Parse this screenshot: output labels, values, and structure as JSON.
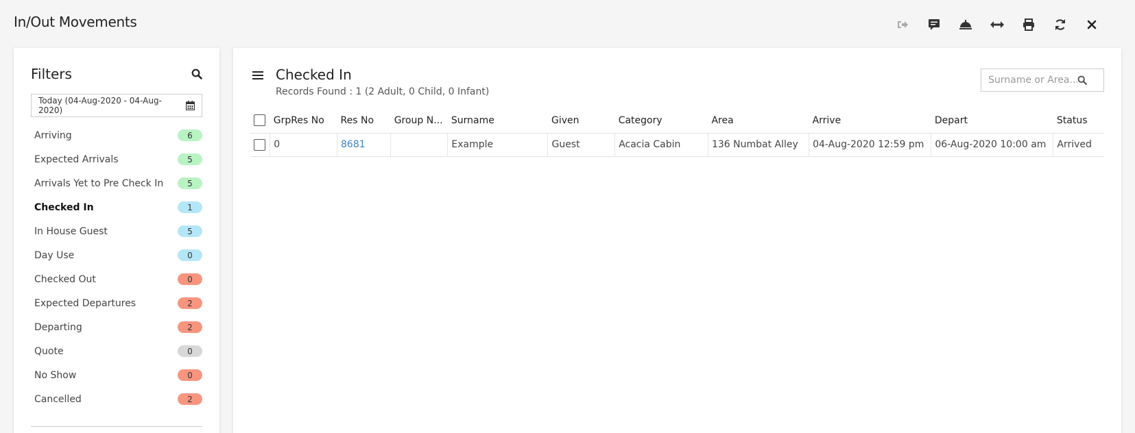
{
  "page": {
    "title": "In/Out Movements"
  },
  "toolbar": {
    "icons": [
      "sign-out-icon",
      "comment-icon",
      "bell-icon",
      "expand-icon",
      "print-icon",
      "refresh-icon",
      "close-icon"
    ]
  },
  "filters": {
    "title": "Filters",
    "date_range": "Today (04-Aug-2020 - 04-Aug-2020)",
    "items": [
      {
        "label": "Arriving",
        "count": "6",
        "color": "green"
      },
      {
        "label": "Expected Arrivals",
        "count": "5",
        "color": "green"
      },
      {
        "label": "Arrivals Yet to Pre Check In",
        "count": "5",
        "color": "green"
      },
      {
        "label": "Checked In",
        "count": "1",
        "color": "blue",
        "active": true
      },
      {
        "label": "In House Guest",
        "count": "5",
        "color": "blue"
      },
      {
        "label": "Day Use",
        "count": "0",
        "color": "blue"
      },
      {
        "label": "Checked Out",
        "count": "0",
        "color": "red"
      },
      {
        "label": "Expected Departures",
        "count": "2",
        "color": "red"
      },
      {
        "label": "Departing",
        "count": "2",
        "color": "red"
      },
      {
        "label": "Quote",
        "count": "0",
        "color": "grey"
      },
      {
        "label": "No Show",
        "count": "0",
        "color": "red"
      },
      {
        "label": "Cancelled",
        "count": "2",
        "color": "red"
      }
    ]
  },
  "main": {
    "title": "Checked In",
    "records": "Records Found : 1 (2 Adult, 0 Child, 0 Infant)",
    "search_placeholder": "Surname or Area...",
    "columns": [
      "GrpRes No",
      "Res No",
      "Group N...",
      "Surname",
      "Given",
      "Category",
      "Area",
      "Arrive",
      "Depart",
      "Status"
    ],
    "rows": [
      [
        "0",
        "8681",
        "",
        "Example",
        "Guest",
        "Acacia Cabin",
        "136 Numbat Alley",
        "04-Aug-2020 12:59 pm",
        "06-Aug-2020 10:00 am",
        "Arrived"
      ]
    ]
  },
  "colors": {
    "badge_green": "#b9f3c4",
    "badge_blue": "#b3e7f8",
    "badge_red": "#f8957f",
    "badge_grey": "#d8d8d8",
    "link": "#3a82c4"
  }
}
